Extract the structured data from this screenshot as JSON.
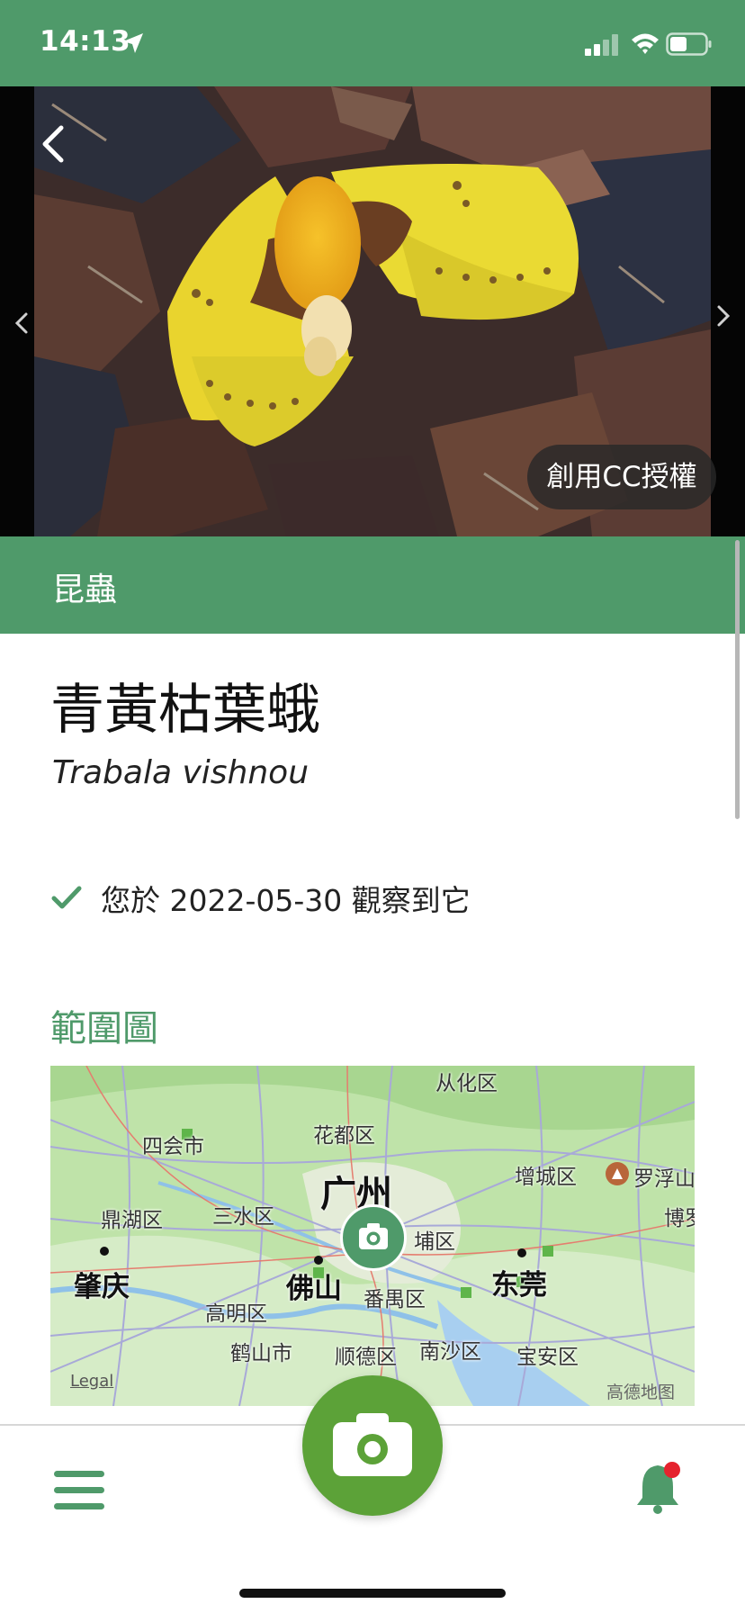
{
  "status_bar": {
    "time": "14:13",
    "color": "#4f9a6a"
  },
  "hero": {
    "license_label": "創用CC授權",
    "back_icon": "chevron-left-icon",
    "prev_icon": "chevron-left-icon",
    "next_icon": "chevron-right-icon"
  },
  "category": {
    "label": "昆蟲",
    "color": "#4f9a6a"
  },
  "species": {
    "common_name": "青黃枯葉蛾",
    "scientific_name": "Trabala vishnou"
  },
  "observation": {
    "text": "您於 2022-05-30 觀察到它",
    "icon": "check-icon"
  },
  "range_map": {
    "title": "範圍圖",
    "legal": "Legal",
    "attribution": "高德地图",
    "labels": {
      "conghua": "从化区",
      "sihui": "四会市",
      "huadu": "花都区",
      "zengcheng": "增城区",
      "luofushan": "罗浮山",
      "boluo": "博罗",
      "dinghu": "鼎湖区",
      "sanshui": "三水区",
      "guangzhou": "广州",
      "huangpu": "埔区",
      "zhaoqing": "肇庆",
      "foshan": "佛山",
      "panyu": "番禺区",
      "dongguan": "东莞",
      "gaoming": "高明区",
      "heshan": "鹤山市",
      "shunde": "顺德区",
      "nansha": "南沙区",
      "baoan": "宝安区"
    }
  },
  "bottom_nav": {
    "menu_icon": "menu-icon",
    "camera_icon": "camera-icon",
    "bell_icon": "bell-icon",
    "accent": "#5ca238",
    "badge_color": "#e5232d"
  }
}
